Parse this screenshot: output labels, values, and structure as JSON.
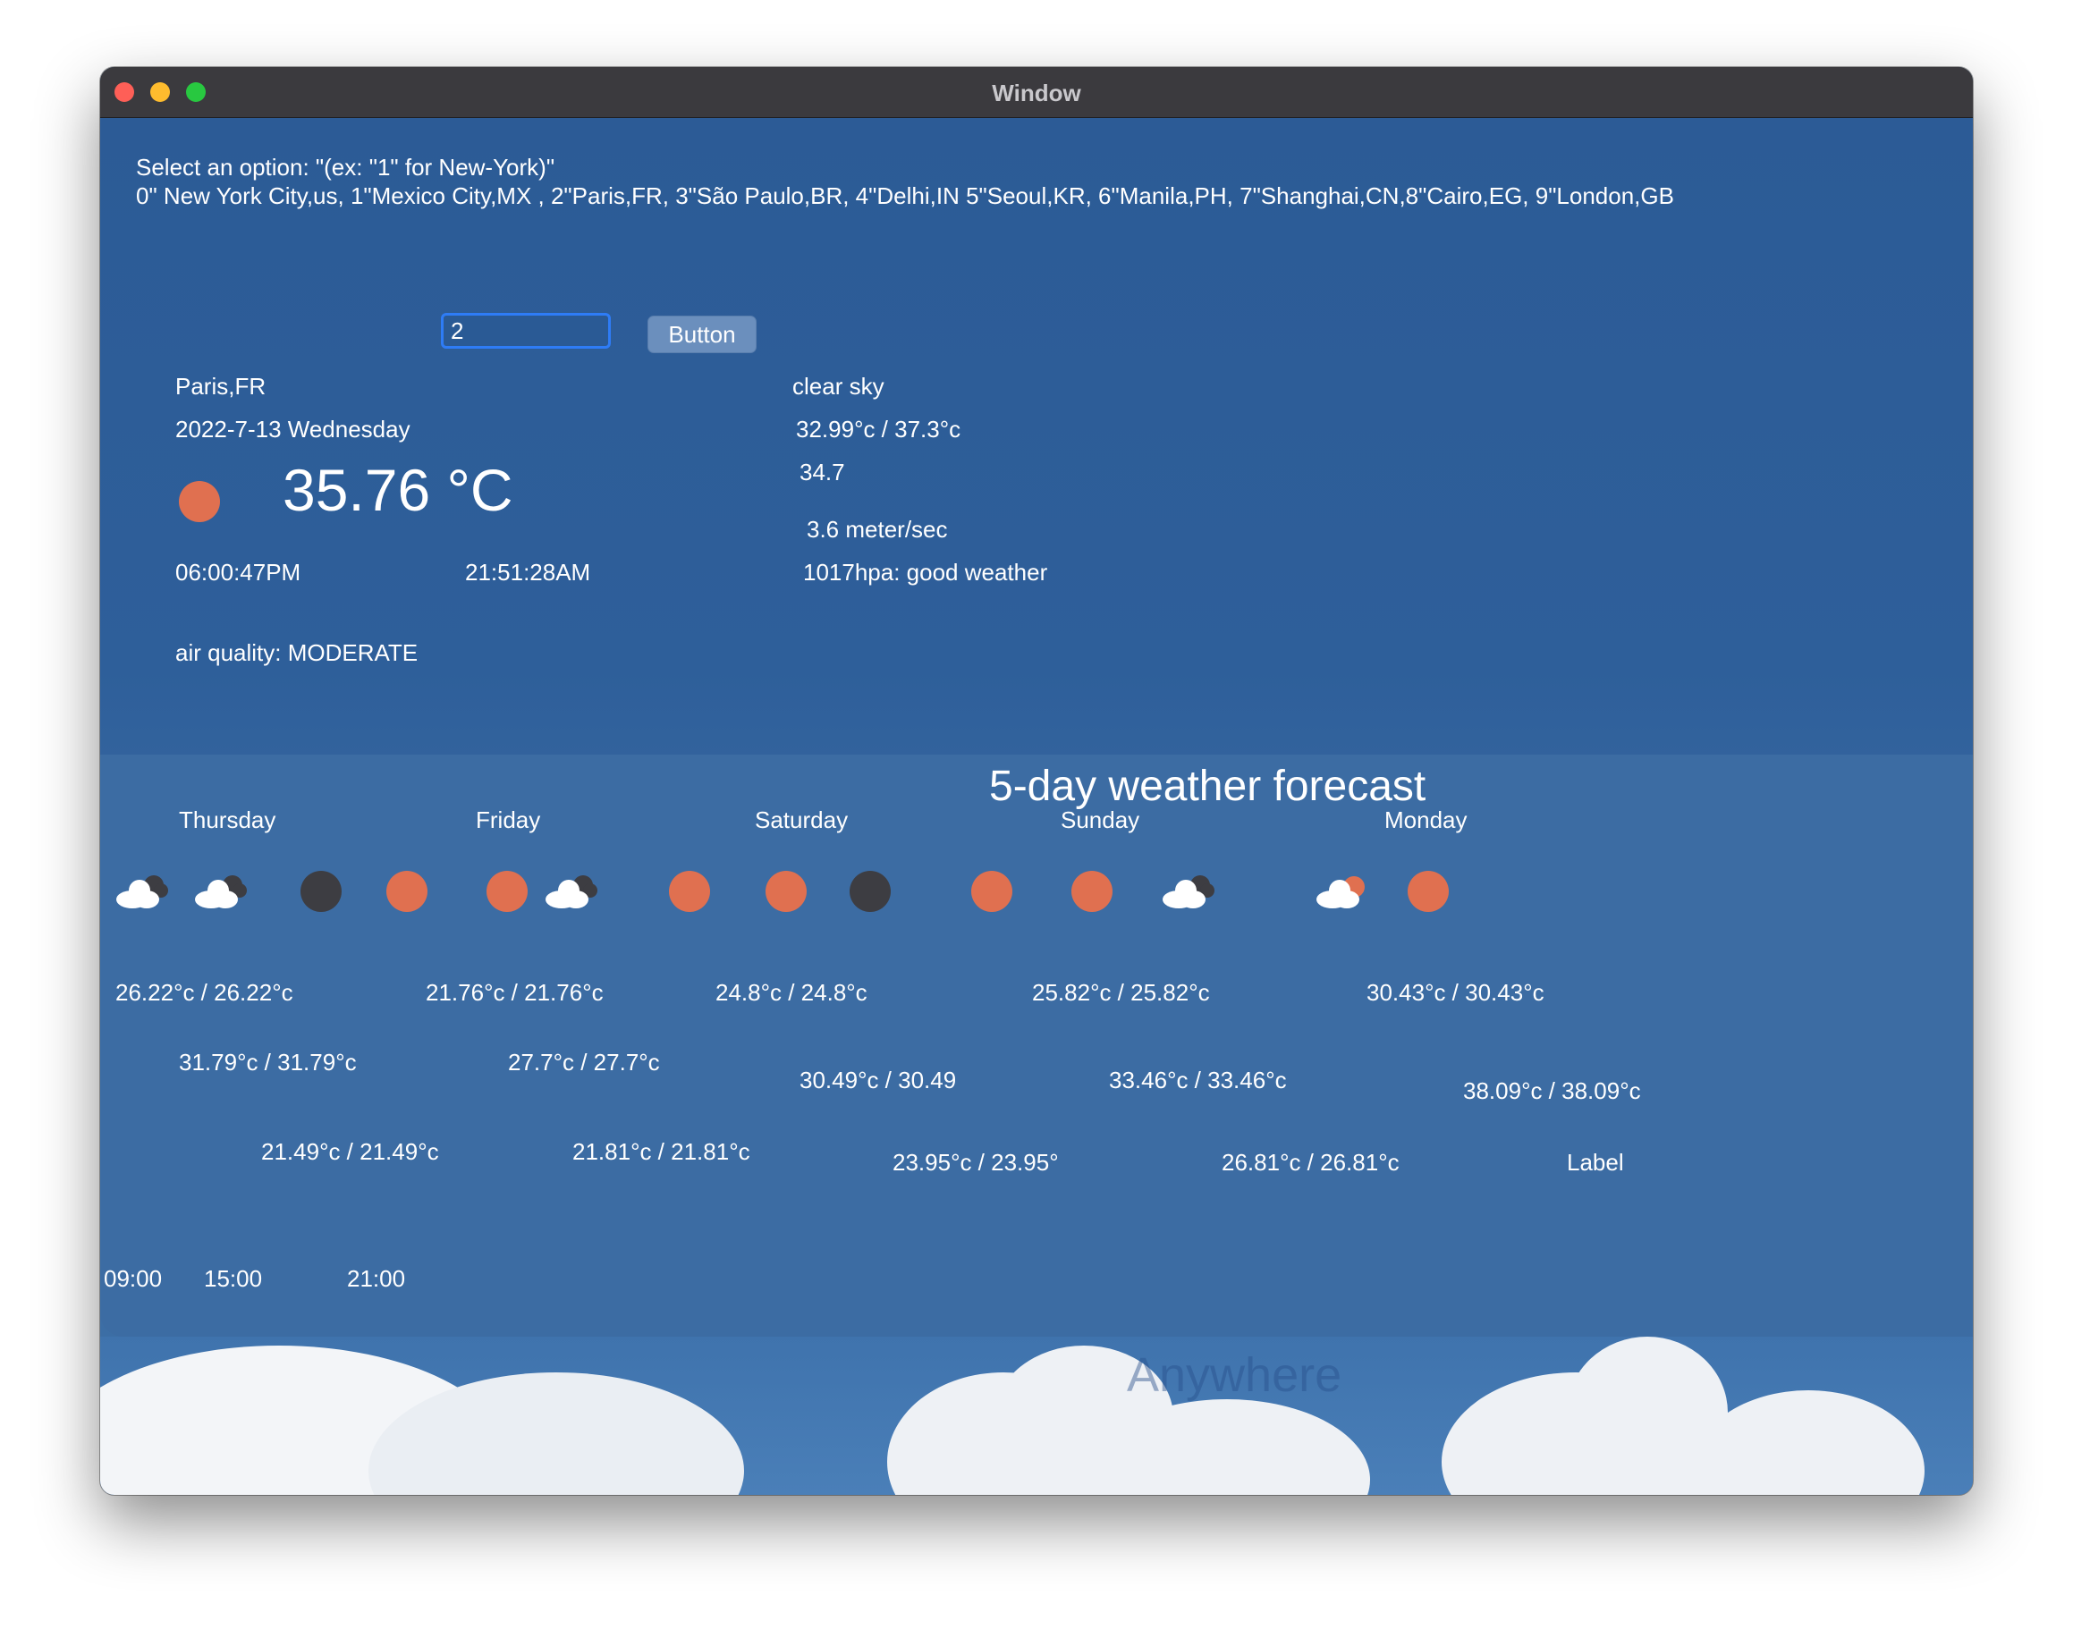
{
  "window": {
    "title": "Window"
  },
  "instructions": {
    "line1": "Select an option: \"(ex: \"1\" for New-York)\"",
    "line2": "0\" New York City,us, 1\"Mexico City,MX , 2\"Paris,FR, 3\"São Paulo,BR, 4\"Delhi,IN 5\"Seoul,KR, 6\"Manila,PH, 7\"Shanghai,CN,8\"Cairo,EG, 9\"London,GB"
  },
  "search": {
    "input_value": "2",
    "button_label": "Button"
  },
  "current": {
    "city": "Paris,FR",
    "date": "2022-7-13 Wednesday",
    "temperature": "35.76 °C",
    "sunrise": "06:00:47PM",
    "sunset": "21:51:28AM",
    "air_quality": "air quality: MODERATE",
    "description": "clear sky",
    "min_max": "32.99°c / 37.3°c",
    "feels_like": "34.7",
    "wind": "3.6 meter/sec",
    "pressure": "1017hpa: good weather",
    "icon": "sun-icon"
  },
  "forecast": {
    "title": "5-day weather forecast",
    "days": [
      "Thursday",
      "Friday",
      "Saturday",
      "Sunday",
      "Monday"
    ],
    "icons": [
      "cloud-night-icon",
      "cloud-night-icon",
      "moon-icon",
      "sun-icon",
      "sun-icon",
      "cloud-night-icon",
      "sun-icon",
      "sun-icon",
      "moon-icon",
      "sun-icon",
      "sun-icon",
      "cloud-night-icon",
      "cloud-sun-icon",
      "sun-icon"
    ],
    "row1": [
      "26.22°c / 26.22°c",
      "21.76°c / 21.76°c",
      "24.8°c / 24.8°c",
      "25.82°c / 25.82°c",
      "30.43°c / 30.43°c"
    ],
    "row2": [
      "31.79°c / 31.79°c",
      "27.7°c / 27.7°c",
      "30.49°c / 30.49",
      "33.46°c / 33.46°c",
      "38.09°c / 38.09°c"
    ],
    "row3": [
      "21.49°c / 21.49°c",
      "21.81°c / 21.81°c",
      "23.95°c / 23.95°",
      "26.81°c / 26.81°c",
      "Label"
    ],
    "times": [
      "09:00",
      "15:00",
      "21:00"
    ]
  },
  "footer": {
    "watermark": "Anywhere"
  }
}
